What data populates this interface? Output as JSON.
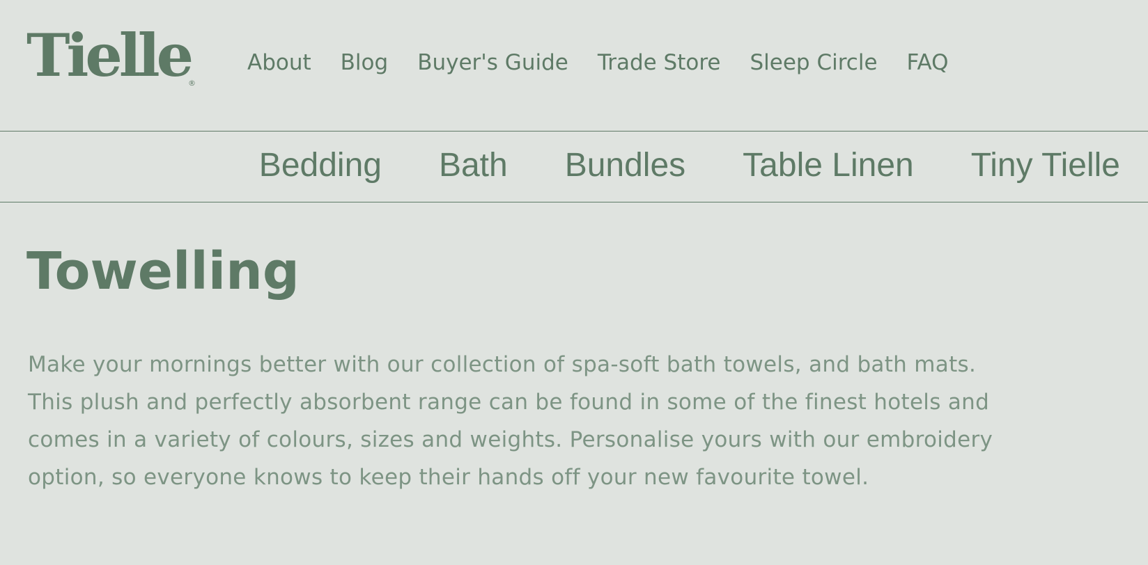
{
  "brand": {
    "logo_text": "Tielle",
    "registered_mark": "®"
  },
  "utility_nav": {
    "items": [
      {
        "label": "About"
      },
      {
        "label": "Blog"
      },
      {
        "label": "Buyer's Guide"
      },
      {
        "label": "Trade Store"
      },
      {
        "label": "Sleep Circle"
      },
      {
        "label": "FAQ"
      }
    ]
  },
  "category_nav": {
    "items": [
      {
        "label": "Bedding"
      },
      {
        "label": "Bath"
      },
      {
        "label": "Bundles"
      },
      {
        "label": "Table Linen"
      },
      {
        "label": "Tiny Tielle"
      }
    ]
  },
  "main": {
    "title": "Towelling",
    "description": "Make your mornings better with our collection of spa-soft bath towels, and bath mats. This plush and perfectly absorbent range can be found in some of the finest hotels and comes in a variety of colours, sizes and weights. Personalise yours with our embroidery option, so everyone knows to keep their hands off your new favourite towel."
  },
  "colors": {
    "background": "#dfe3df",
    "brand_green": "#5e7a66",
    "body_text": "#7d9484"
  }
}
